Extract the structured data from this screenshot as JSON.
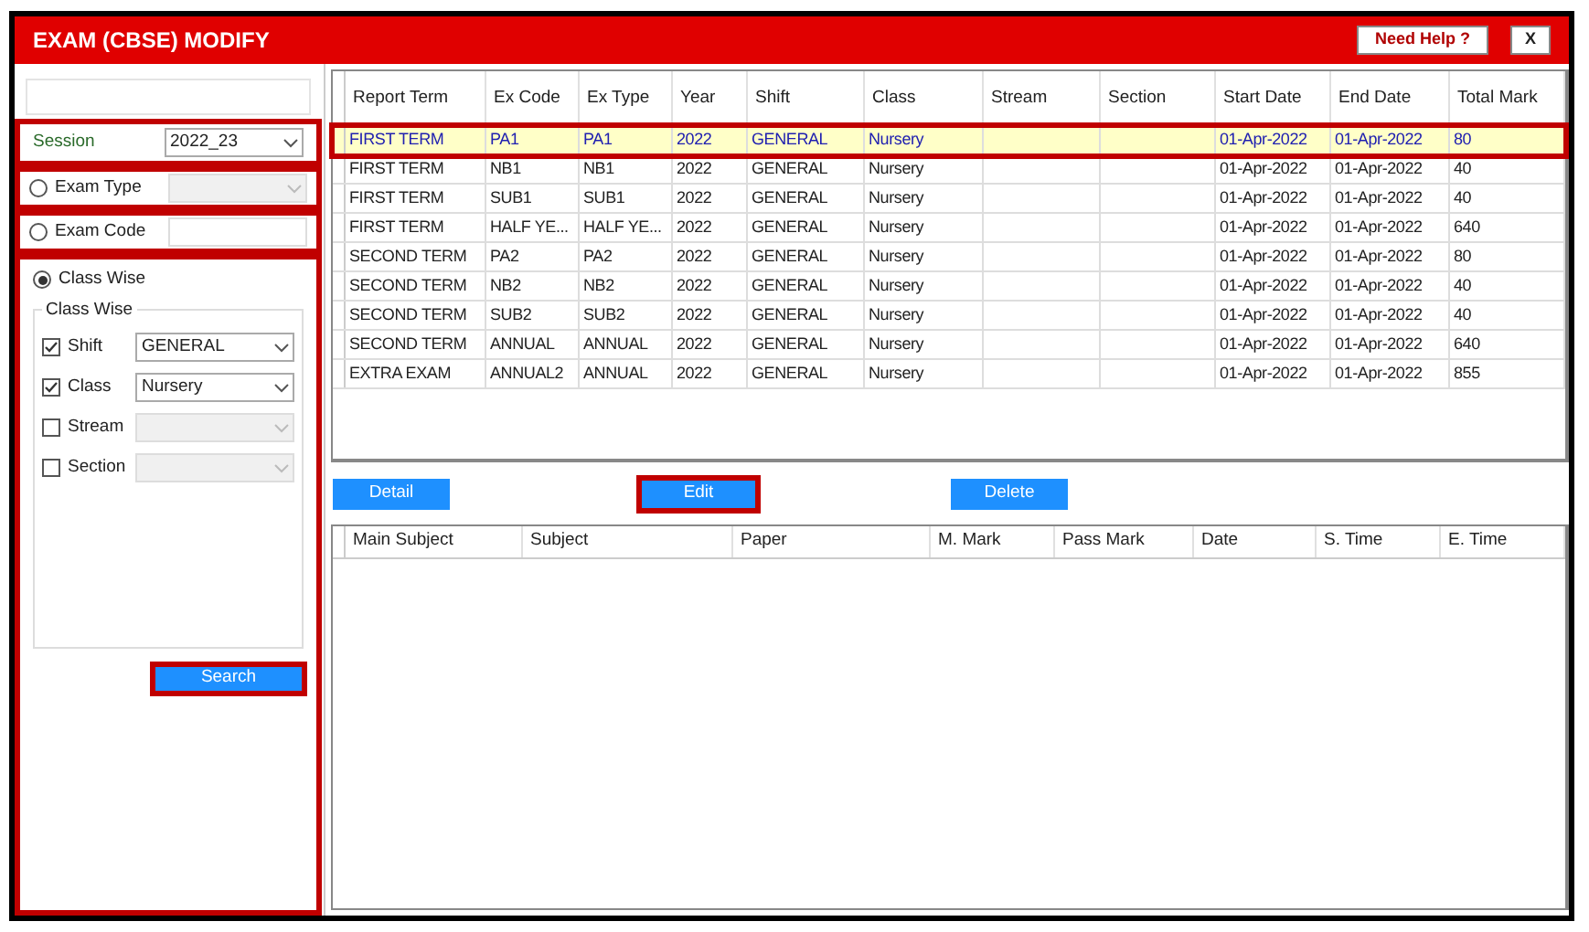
{
  "window": {
    "title": "EXAM (CBSE) MODIFY",
    "help_button": "Need Help ?",
    "close_button": "X"
  },
  "filters": {
    "session": {
      "label": "Session",
      "value": "2022_23",
      "highlighted": true
    },
    "options": [
      {
        "label": "Exam Type",
        "kind": "select",
        "selected": false,
        "highlighted": true
      },
      {
        "label": "Exam Code",
        "kind": "text",
        "selected": false,
        "highlighted": true
      },
      {
        "label": "Class Wise",
        "kind": "group",
        "selected": true,
        "highlighted": true
      }
    ],
    "group_title": "Class Wise",
    "fields": [
      {
        "label": "Shift",
        "checked": true,
        "value": "GENERAL"
      },
      {
        "label": "Class",
        "checked": true,
        "value": "Nursery"
      },
      {
        "label": "Stream",
        "checked": false
      },
      {
        "label": "Section",
        "checked": false
      }
    ],
    "search_button": {
      "label": "Search",
      "highlighted": true
    }
  },
  "exam_table": {
    "columns": [
      "Report Term",
      "Ex Code",
      "Ex Type",
      "Year",
      "Shift",
      "Class",
      "Stream",
      "Section",
      "Start Date",
      "End Date",
      "Total Mark"
    ],
    "rows": [
      {
        "selected": true,
        "highlighted": true,
        "cells": [
          "FIRST TERM",
          "PA1",
          "PA1",
          "2022",
          "GENERAL",
          "Nursery",
          "",
          "",
          "01-Apr-2022",
          "01-Apr-2022",
          "80"
        ]
      },
      {
        "selected": false,
        "highlighted": false,
        "cells": [
          "FIRST TERM",
          "NB1",
          "NB1",
          "2022",
          "GENERAL",
          "Nursery",
          "",
          "",
          "01-Apr-2022",
          "01-Apr-2022",
          "40"
        ]
      },
      {
        "selected": false,
        "highlighted": false,
        "cells": [
          "FIRST TERM",
          "SUB1",
          "SUB1",
          "2022",
          "GENERAL",
          "Nursery",
          "",
          "",
          "01-Apr-2022",
          "01-Apr-2022",
          "40"
        ]
      },
      {
        "selected": false,
        "highlighted": false,
        "cells": [
          "FIRST TERM",
          "HALF YE...",
          "HALF YE...",
          "2022",
          "GENERAL",
          "Nursery",
          "",
          "",
          "01-Apr-2022",
          "01-Apr-2022",
          "640"
        ]
      },
      {
        "selected": false,
        "highlighted": false,
        "cells": [
          "SECOND TERM",
          "PA2",
          "PA2",
          "2022",
          "GENERAL",
          "Nursery",
          "",
          "",
          "01-Apr-2022",
          "01-Apr-2022",
          "80"
        ]
      },
      {
        "selected": false,
        "highlighted": false,
        "cells": [
          "SECOND TERM",
          "NB2",
          "NB2",
          "2022",
          "GENERAL",
          "Nursery",
          "",
          "",
          "01-Apr-2022",
          "01-Apr-2022",
          "40"
        ]
      },
      {
        "selected": false,
        "highlighted": false,
        "cells": [
          "SECOND TERM",
          "SUB2",
          "SUB2",
          "2022",
          "GENERAL",
          "Nursery",
          "",
          "",
          "01-Apr-2022",
          "01-Apr-2022",
          "40"
        ]
      },
      {
        "selected": false,
        "highlighted": false,
        "cells": [
          "SECOND TERM",
          "ANNUAL",
          "ANNUAL",
          "2022",
          "GENERAL",
          "Nursery",
          "",
          "",
          "01-Apr-2022",
          "01-Apr-2022",
          "640"
        ]
      },
      {
        "selected": false,
        "highlighted": false,
        "cells": [
          "EXTRA EXAM",
          "ANNUAL2",
          "ANNUAL",
          "2022",
          "GENERAL",
          "Nursery",
          "",
          "",
          "01-Apr-2022",
          "01-Apr-2022",
          "855"
        ]
      }
    ]
  },
  "actions": [
    {
      "label": "Detail",
      "highlighted": false
    },
    {
      "label": "Edit",
      "highlighted": true
    },
    {
      "label": "Delete",
      "highlighted": false
    }
  ],
  "subject_table": {
    "columns": [
      "Main Subject",
      "Subject",
      "Paper",
      "M. Mark",
      "Pass Mark",
      "Date",
      "S. Time",
      "E. Time"
    ]
  }
}
